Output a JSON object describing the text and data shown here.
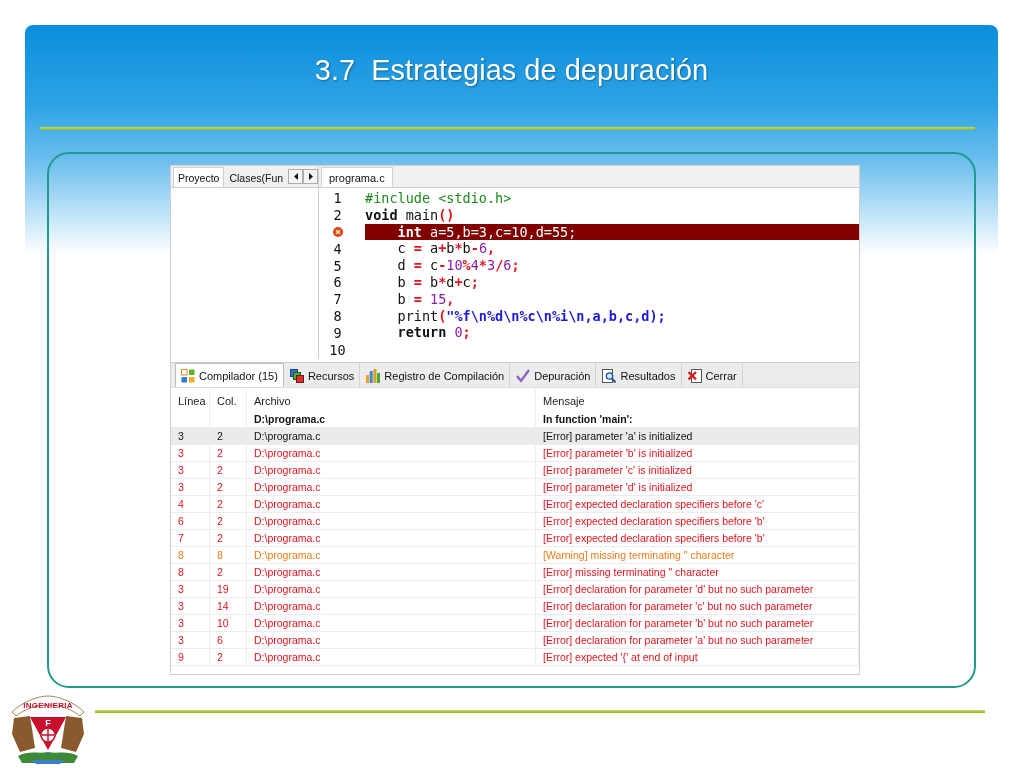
{
  "slide": {
    "title": "3.7  Estrategias de depuración"
  },
  "logo": {
    "banner_text": "INGENIERIA",
    "shield_letter": "F"
  },
  "ide": {
    "project_tabs": [
      {
        "label": "Proyecto",
        "selected": true
      },
      {
        "label": "Clases(Fun",
        "selected": false
      }
    ],
    "editor_tabs": [
      {
        "label": "programa.c",
        "selected": true
      }
    ],
    "code_lines": [
      {
        "number": "1",
        "error": false,
        "tokens": [
          {
            "text": "#include <stdio.h>",
            "kind": "preprocessor"
          }
        ]
      },
      {
        "number": "2",
        "error": false,
        "tokens": [
          {
            "text": "void",
            "kind": "keyword"
          },
          {
            "text": " main",
            "kind": "plain"
          },
          {
            "text": "()",
            "kind": "operator"
          }
        ],
        "children": [
          {
            "error": true,
            "tokens": [
              {
                "text": "int",
                "kind": "keyword"
              },
              {
                "text": " a=5,b=3,c=10,d=55;",
                "kind": "plain"
              }
            ]
          },
          {
            "number": "4",
            "error": false,
            "tokens": [
              {
                "text": "c ",
                "kind": "plain"
              },
              {
                "text": "=",
                "kind": "operator"
              },
              {
                "text": " a",
                "kind": "plain"
              },
              {
                "text": "+",
                "kind": "operator"
              },
              {
                "text": "b",
                "kind": "plain"
              },
              {
                "text": "*",
                "kind": "operator"
              },
              {
                "text": "b",
                "kind": "plain"
              },
              {
                "text": "-",
                "kind": "operator"
              },
              {
                "text": "6",
                "kind": "number"
              },
              {
                "text": ",",
                "kind": "operator"
              }
            ]
          },
          {
            "number": "5",
            "error": false,
            "tokens": [
              {
                "text": "d ",
                "kind": "plain"
              },
              {
                "text": "=",
                "kind": "operator"
              },
              {
                "text": " c",
                "kind": "plain"
              },
              {
                "text": "-",
                "kind": "operator"
              },
              {
                "text": "10",
                "kind": "number"
              },
              {
                "text": "%",
                "kind": "operator"
              },
              {
                "text": "4",
                "kind": "number"
              },
              {
                "text": "*",
                "kind": "operator"
              },
              {
                "text": "3",
                "kind": "number"
              },
              {
                "text": "/",
                "kind": "operator"
              },
              {
                "text": "6",
                "kind": "number"
              },
              {
                "text": ";",
                "kind": "operator"
              }
            ]
          },
          {
            "number": "6",
            "error": false,
            "tokens": [
              {
                "text": "b ",
                "kind": "plain"
              },
              {
                "text": "=",
                "kind": "operator"
              },
              {
                "text": " b",
                "kind": "plain"
              },
              {
                "text": "*",
                "kind": "operator"
              },
              {
                "text": "d",
                "kind": "plain"
              },
              {
                "text": "+",
                "kind": "operator"
              },
              {
                "text": "c",
                "kind": "plain"
              },
              {
                "text": ";",
                "kind": "operator"
              }
            ]
          },
          {
            "number": "7",
            "error": false,
            "tokens": [
              {
                "text": "b ",
                "kind": "plain"
              },
              {
                "text": "=",
                "kind": "operator"
              },
              {
                "text": " 15",
                "kind": "number"
              },
              {
                "text": ",",
                "kind": "operator"
              }
            ]
          },
          {
            "number": "8",
            "error": false,
            "tokens": [
              {
                "text": "print",
                "kind": "plain"
              },
              {
                "text": "(",
                "kind": "operator"
              },
              {
                "text": "\"%f\\n%d\\n%c\\n%i\\n,a,b,c,d);",
                "kind": "string"
              }
            ]
          },
          {
            "number": "9",
            "error": false,
            "tokens": [
              {
                "text": "return",
                "kind": "keyword"
              },
              {
                "text": " 0",
                "kind": "number"
              },
              {
                "text": ";",
                "kind": "operator"
              }
            ]
          }
        ]
      },
      {
        "number": "10",
        "error": false
      }
    ],
    "output_tabs": [
      {
        "label": "Compilador (15)",
        "selected": true
      },
      {
        "label": "Recursos",
        "selected": false
      },
      {
        "label": "Registro de Compilación",
        "selected": false
      },
      {
        "label": "Depuración",
        "selected": false
      },
      {
        "label": "Resultados",
        "selected": false
      },
      {
        "label": "Cerrar",
        "selected": false
      }
    ],
    "table": {
      "columns": [
        "Línea",
        "Col.",
        "Archivo",
        "Mensaje"
      ],
      "rows": [
        {
          "kind": "info",
          "selected": false,
          "file": "D:\\programa.c",
          "message": "In function 'main':"
        },
        {
          "kind": "error",
          "selected": true,
          "line": "3",
          "col": "2",
          "file": "D:\\programa.c",
          "message": "[Error] parameter 'a' is initialized"
        },
        {
          "kind": "error",
          "selected": false,
          "line": "3",
          "col": "2",
          "file": "D:\\programa.c",
          "message": "[Error] parameter 'b' is initialized"
        },
        {
          "kind": "error",
          "selected": false,
          "line": "3",
          "col": "2",
          "file": "D:\\programa.c",
          "message": "[Error] parameter 'c' is initialized"
        },
        {
          "kind": "error",
          "selected": false,
          "line": "3",
          "col": "2",
          "file": "D:\\programa.c",
          "message": "[Error] parameter 'd' is initialized"
        },
        {
          "kind": "error",
          "selected": false,
          "line": "4",
          "col": "2",
          "file": "D:\\programa.c",
          "message": "[Error] expected declaration specifiers before 'c'"
        },
        {
          "kind": "error",
          "selected": false,
          "line": "6",
          "col": "2",
          "file": "D:\\programa.c",
          "message": "[Error] expected declaration specifiers before 'b'"
        },
        {
          "kind": "error",
          "selected": false,
          "line": "7",
          "col": "2",
          "file": "D:\\programa.c",
          "message": "[Error] expected declaration specifiers before 'b'"
        },
        {
          "kind": "warning",
          "selected": false,
          "line": "8",
          "col": "8",
          "file": "D:\\programa.c",
          "message": "[Warning] missing terminating \" character"
        },
        {
          "kind": "error",
          "selected": false,
          "line": "8",
          "col": "2",
          "file": "D:\\programa.c",
          "message": "[Error] missing terminating \" character"
        },
        {
          "kind": "error",
          "selected": false,
          "line": "3",
          "col": "19",
          "file": "D:\\programa.c",
          "message": "[Error] declaration for parameter 'd' but no such parameter"
        },
        {
          "kind": "error",
          "selected": false,
          "line": "3",
          "col": "14",
          "file": "D:\\programa.c",
          "message": "[Error] declaration for parameter 'c' but no such parameter"
        },
        {
          "kind": "error",
          "selected": false,
          "line": "3",
          "col": "10",
          "file": "D:\\programa.c",
          "message": "[Error] declaration for parameter 'b' but no such parameter"
        },
        {
          "kind": "error",
          "selected": false,
          "line": "3",
          "col": "6",
          "file": "D:\\programa.c",
          "message": "[Error] declaration for parameter 'a' but no such parameter"
        },
        {
          "kind": "error",
          "selected": false,
          "line": "9",
          "col": "2",
          "file": "D:\\programa.c",
          "message": "[Error] expected '{' at end of input"
        }
      ]
    }
  }
}
